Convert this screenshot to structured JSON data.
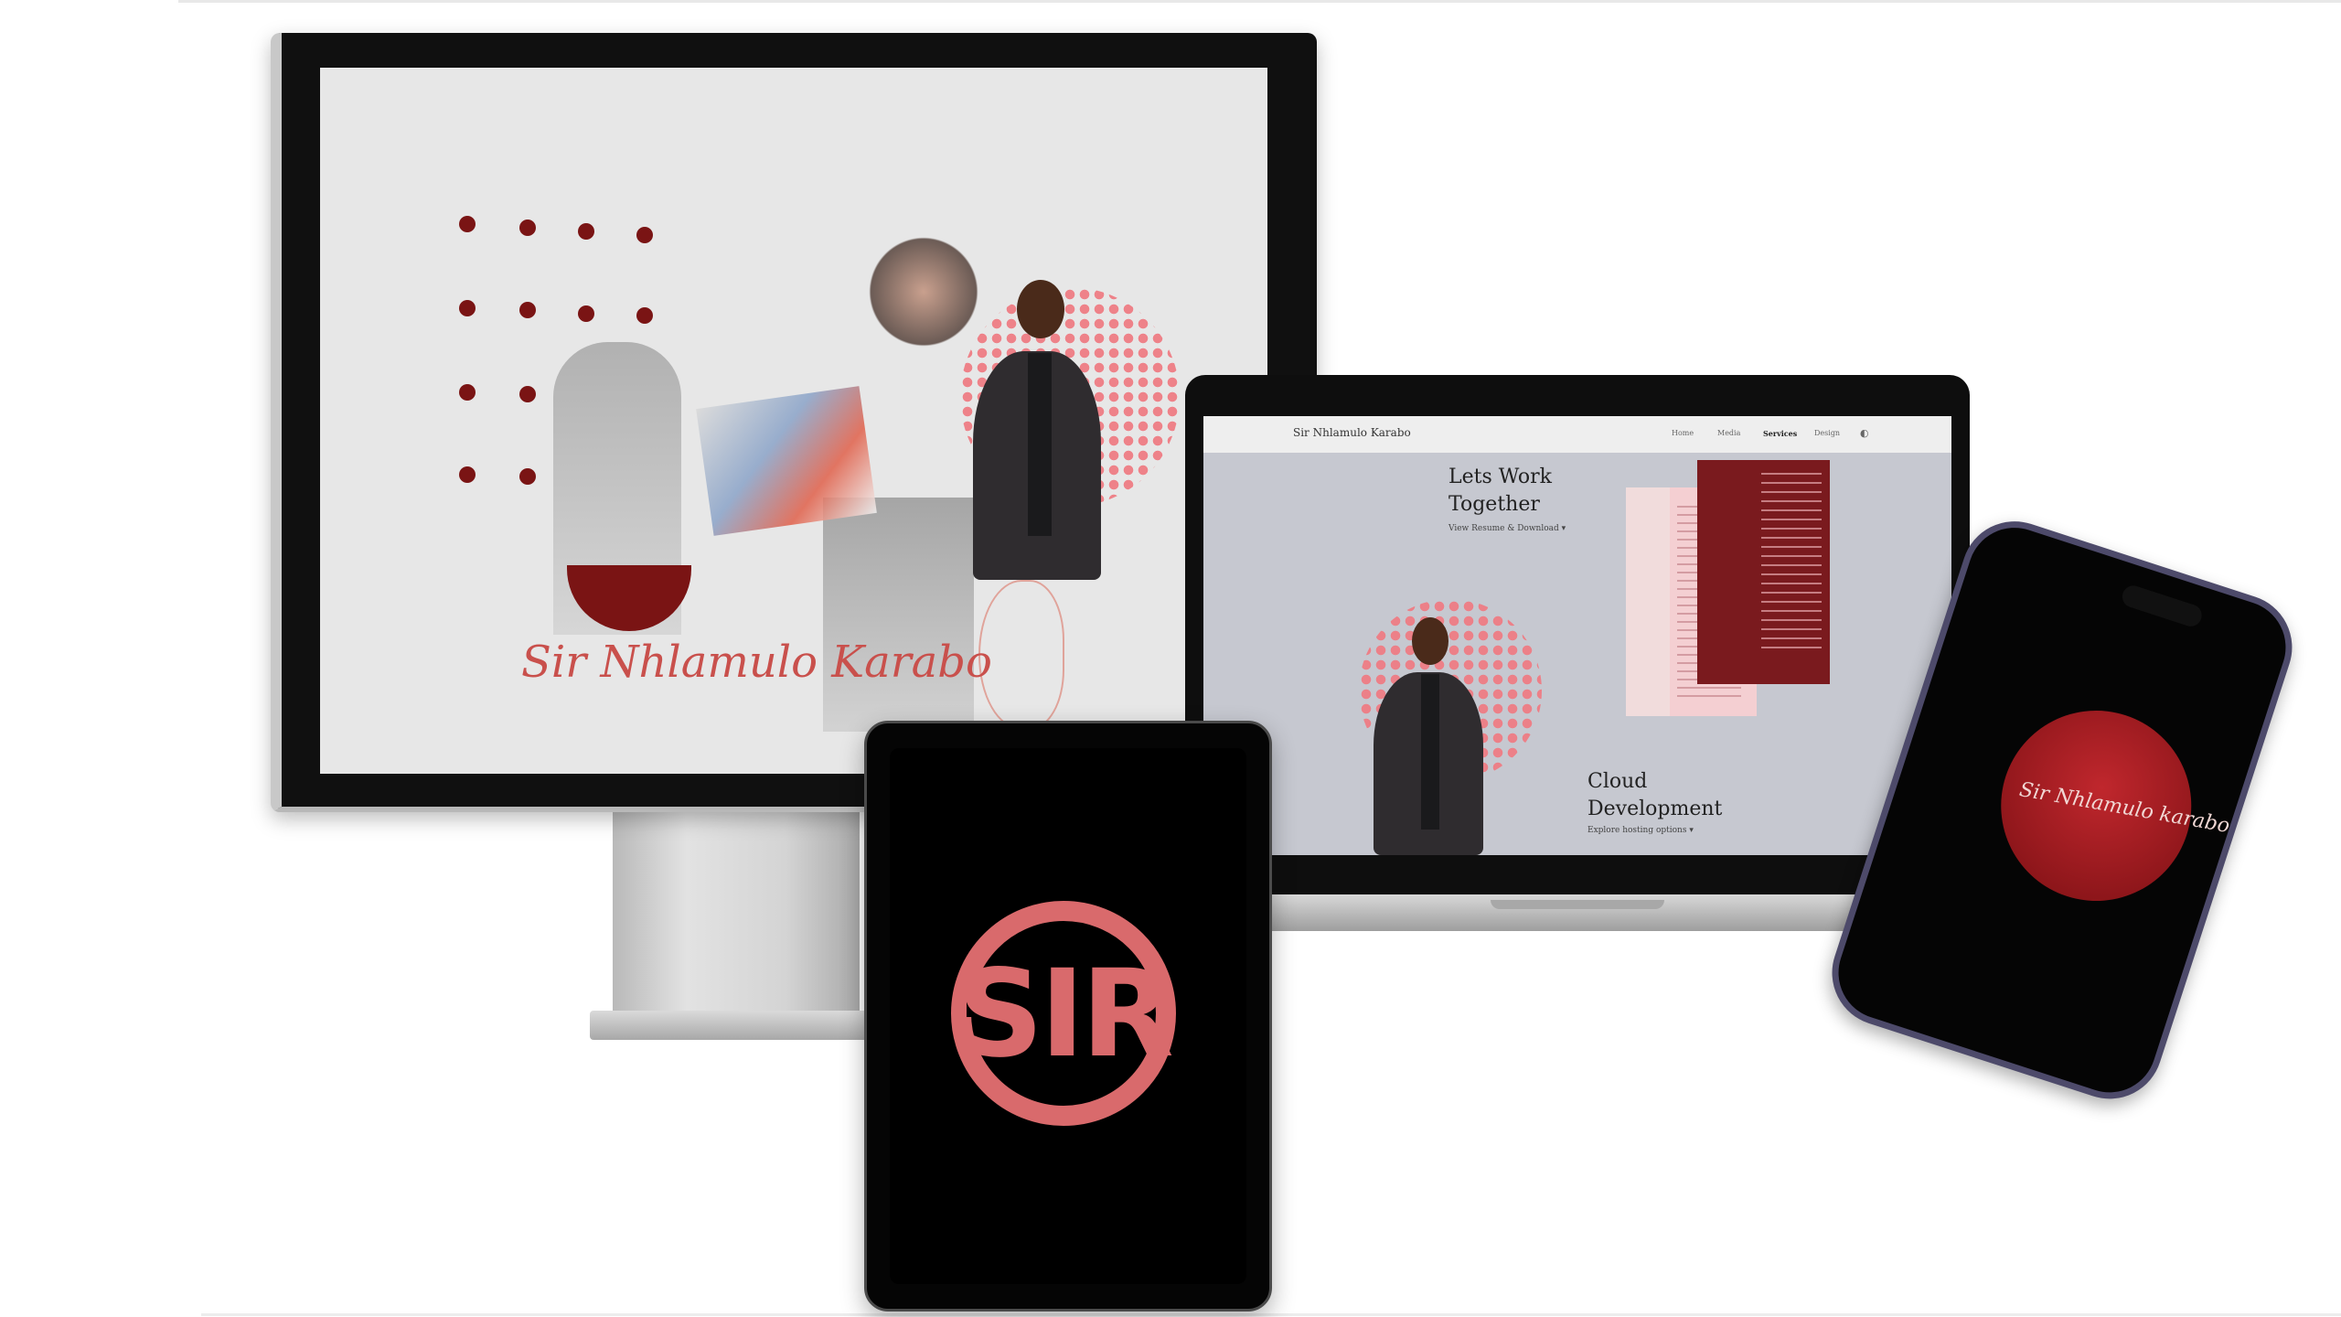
{
  "desktop": {
    "signature": "Sir Nhlamulo Karabo"
  },
  "laptop": {
    "nav": {
      "brand": "Sir Nhlamulo Karabo",
      "items": [
        "Home",
        "Media",
        "Services",
        "Design"
      ]
    },
    "hero": {
      "title": "Lets Work Together",
      "link": "View Resume & Download"
    },
    "feature": {
      "title": "Cloud Development",
      "link": "Explore hosting options"
    }
  },
  "tablet": {
    "logo": "SIR"
  },
  "phone": {
    "signature": "Sir Nhlamulo karabo"
  },
  "colors": {
    "accent_dark_red": "#7a1414",
    "accent_pink": "#ef7d85",
    "logo_rose": "#d96a6c",
    "phone_red": "#c0272d"
  }
}
